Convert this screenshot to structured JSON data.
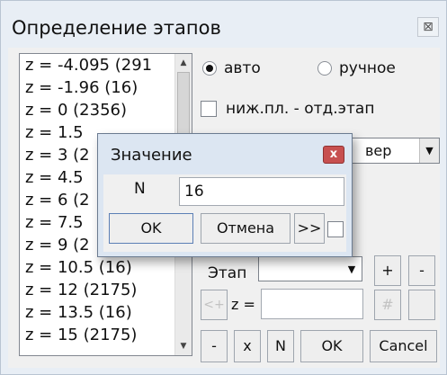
{
  "window": {
    "title": "Определение этапов",
    "close_symbol": "⊠"
  },
  "stages_list": {
    "items": [
      "z = -4.095  (291",
      "z = -1.96  (16)",
      "z = 0  (2356)",
      "z = 1.5",
      "z = 3  (2",
      "z = 4.5",
      "z = 6  (2",
      "z = 7.5",
      "z = 9  (2",
      "z = 10.5  (16)",
      "z = 12  (2175)",
      "z = 13.5  (16)",
      "z = 15  (2175)"
    ],
    "scroll_up": "▲",
    "scroll_down": "▼"
  },
  "mode": {
    "auto_label": "авто",
    "manual_label": "ручное",
    "selected": "auto"
  },
  "bottom_layer_checkbox": {
    "label": "ниж.пл. - отд.этап",
    "checked": false
  },
  "direction_combo": {
    "value": "вер",
    "arrow": "▼"
  },
  "stage_row": {
    "label": "Этап",
    "arrow": "▼",
    "add_label": "+",
    "remove_label": "-"
  },
  "z_row": {
    "prev_label": "<+",
    "z_label": "z =",
    "hash_label": "#"
  },
  "bottom_buttons": {
    "minus": "-",
    "x": "x",
    "n": "N",
    "ok": "OK",
    "cancel": "Cancel"
  },
  "value_dialog": {
    "title": "Значение",
    "close_symbol": "x",
    "field_label": "N",
    "field_value": "16",
    "ok_label": "OK",
    "cancel_label": "Отмена",
    "more_label": ">>"
  }
}
